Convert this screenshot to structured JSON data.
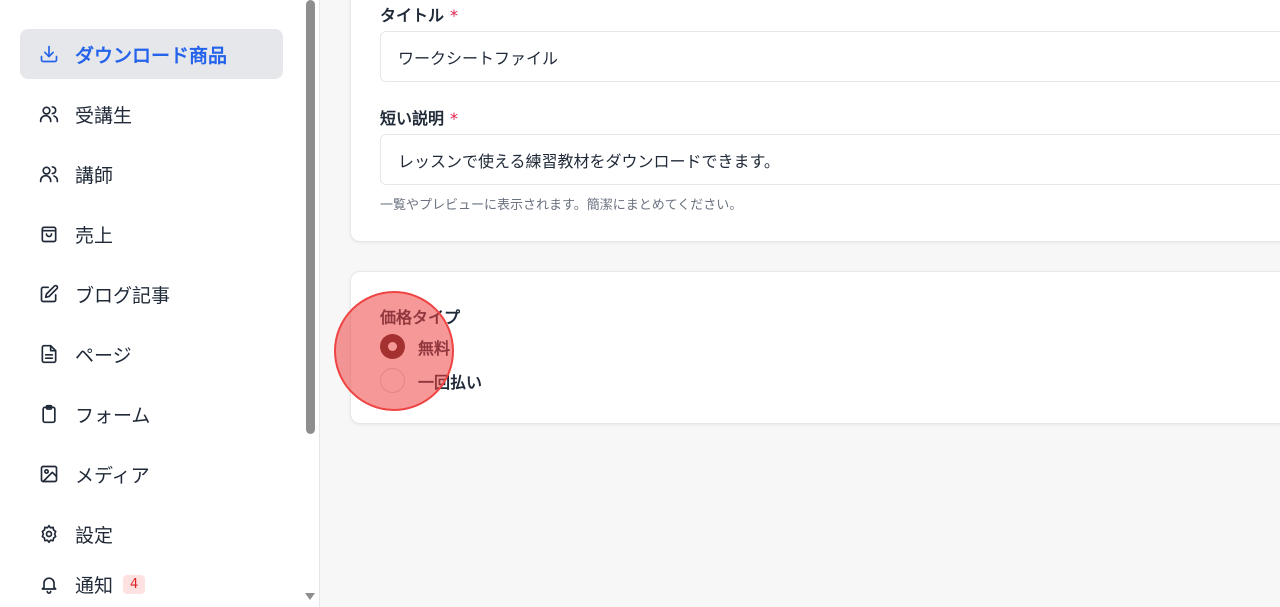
{
  "sidebar": {
    "items": [
      {
        "label": "ダウンロード商品",
        "icon": "download-icon",
        "active": true
      },
      {
        "label": "受講生",
        "icon": "users-icon"
      },
      {
        "label": "講師",
        "icon": "users-icon"
      },
      {
        "label": "売上",
        "icon": "shopping-bag-icon"
      },
      {
        "label": "ブログ記事",
        "icon": "edit-icon"
      },
      {
        "label": "ページ",
        "icon": "file-text-icon"
      },
      {
        "label": "フォーム",
        "icon": "clipboard-icon"
      },
      {
        "label": "メディア",
        "icon": "image-icon"
      },
      {
        "label": "設定",
        "icon": "gear-icon"
      },
      {
        "label": "通知",
        "icon": "bell-icon",
        "badge": "4"
      }
    ]
  },
  "form": {
    "title_label": "タイトル",
    "title_required": "*",
    "title_value": "ワークシートファイル",
    "desc_label": "短い説明",
    "desc_required": "*",
    "desc_value": "レッスンで使える練習教材をダウンロードできます。",
    "desc_help": "一覧やプレビューに表示されます。簡潔にまとめてください。"
  },
  "pricing": {
    "label": "価格タイプ",
    "options": [
      {
        "label": "無料",
        "checked": true
      },
      {
        "label": "一回払い",
        "checked": false
      }
    ]
  },
  "colors": {
    "accent": "#2563eb",
    "radio_checked": "#4a1a1a",
    "badge": "#dc2626",
    "required": "#e11d48"
  }
}
